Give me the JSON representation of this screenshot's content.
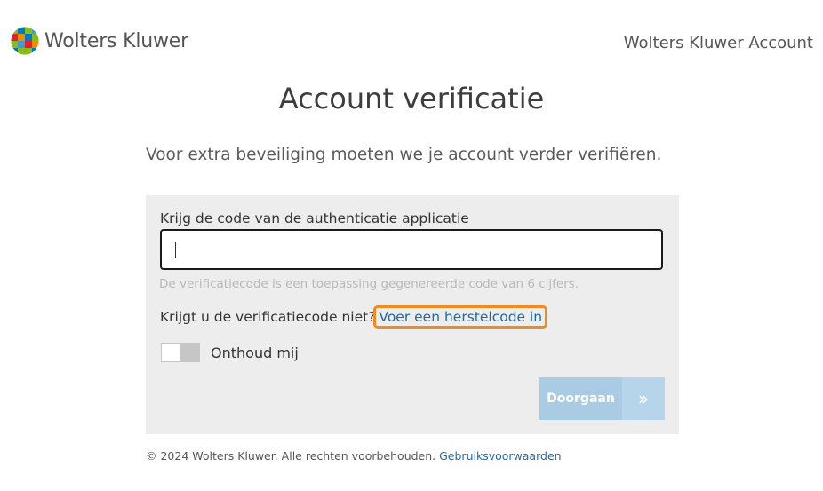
{
  "header": {
    "logo_text": "Wolters Kluwer",
    "account_label": "Wolters Kluwer Account"
  },
  "main": {
    "title": "Account verificatie",
    "subtitle": "Voor extra beveiliging moeten we je account verder verifiëren."
  },
  "form": {
    "code_label": "Krijg de code van de authenticatie applicatie",
    "code_value": "",
    "hint": "De verificatiecode is een toepassing gegenereerde code van 6 cijfers.",
    "recovery_text": "Krijgt u de verificatiecode niet?",
    "recovery_link": "Voer een herstelcode in",
    "remember_label": "Onthoud mij",
    "remember_on": false,
    "submit_label": "Doorgaan",
    "submit_icon": "chevron-double-right-icon"
  },
  "footer": {
    "copyright": "© 2024 Wolters Kluwer. Alle rechten voorbehouden.",
    "terms_link": "Gebruiksvoorwaarden"
  },
  "colors": {
    "link": "#1c6aa6",
    "highlight": "#f28a1e",
    "panel": "#ededed",
    "button": "#a9cce4"
  }
}
